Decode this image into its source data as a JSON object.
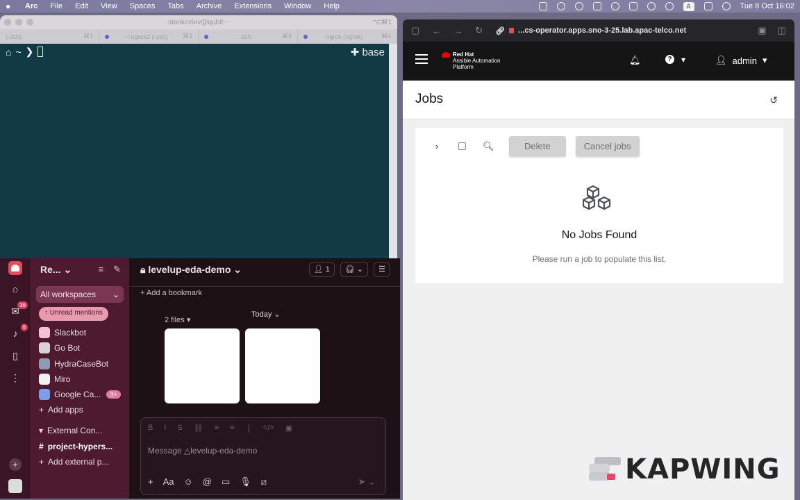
{
  "menubar": {
    "app": "Arc",
    "items": [
      "File",
      "Edit",
      "View",
      "Spaces",
      "Tabs",
      "Archive",
      "Extensions",
      "Window",
      "Help"
    ],
    "datetime": "Tue 8 Oct  16:02",
    "input_source": "A"
  },
  "terminal": {
    "title": "stankoziov@qubit:~",
    "shortcut": "⌥⌘1",
    "tabs": [
      {
        "label": "(-zsh)",
        "shortcut": "⌘1"
      },
      {
        "label": "~/.ngrok2 (-zsh)",
        "shortcut": "⌘2"
      },
      {
        "label": "-zsh",
        "shortcut": "⌘3"
      },
      {
        "label": "ngrok (ngrok)",
        "shortcut": "⌘4"
      }
    ],
    "prompt_dir": "~",
    "prompt_symbol": "❯",
    "env": "base"
  },
  "slack": {
    "rail": {
      "badges": {
        "dms": "36",
        "activity": "6"
      }
    },
    "workspace_name": "Re...",
    "all_workspaces": "All workspaces",
    "apps_partial": "Apps",
    "unread_mentions": "Unread mentions",
    "sidebar_items": [
      {
        "label": "Slackbot"
      },
      {
        "label": "Go Bot"
      },
      {
        "label": "HydraCaseBot"
      },
      {
        "label": "Miro"
      },
      {
        "label": "Google Ca...",
        "badge": "9+"
      },
      {
        "label": "Add apps"
      }
    ],
    "external_section": "External Con...",
    "external_channel": "project-hypers...",
    "add_external": "Add external p...",
    "channel": "levelup-eda-demo",
    "member_count": "1",
    "add_bookmark": "Add a bookmark",
    "today": "Today",
    "files_label": "2 files",
    "message_placeholder": "Message △levelup-eda-demo"
  },
  "browser": {
    "url": "...cs-operator.apps.sno-3-25.lab.apac-telco.net",
    "brand": {
      "line1": "Red Hat",
      "line2": "Ansible Automation",
      "line3": "Platform"
    },
    "user": "admin",
    "page_title": "Jobs",
    "buttons": {
      "delete": "Delete",
      "cancel": "Cancel jobs"
    },
    "empty_title": "No Jobs Found",
    "empty_text": "Please run a job to populate this list."
  },
  "watermark": "KAPWING",
  "colors": {
    "slack_sidebar": "#4d1a2f",
    "terminal_bg": "#123a45",
    "aap_header": "#151515",
    "redhat_red": "#ee0000"
  }
}
